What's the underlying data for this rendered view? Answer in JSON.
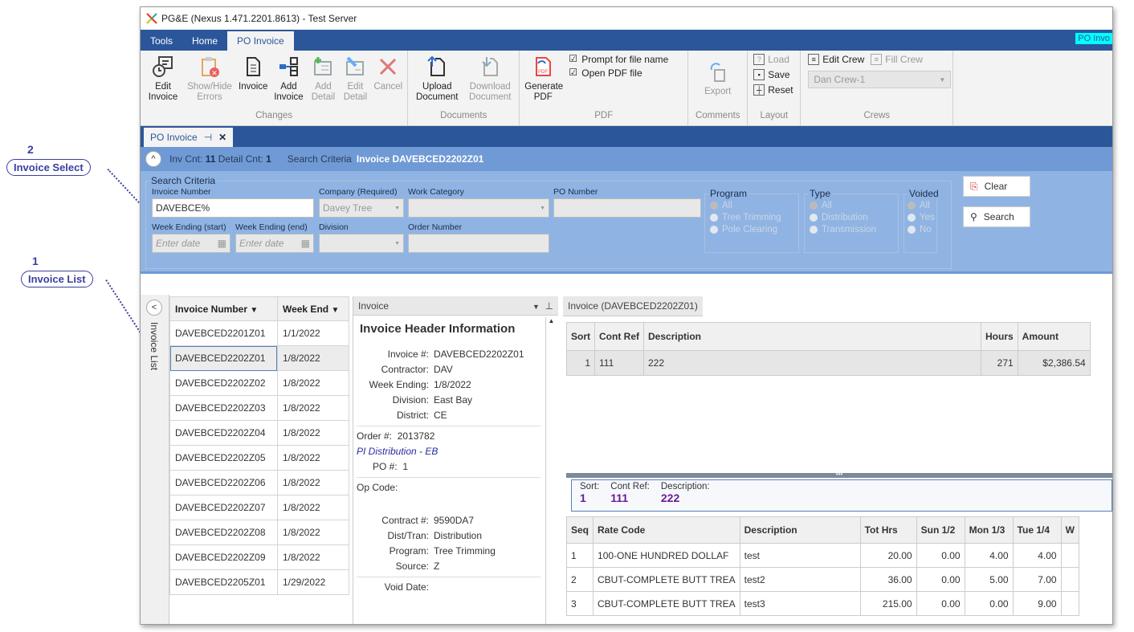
{
  "callouts": [
    {
      "num": "2",
      "label": "Invoice Select"
    },
    {
      "num": "1",
      "label": "Invoice List"
    }
  ],
  "window": {
    "title": "PG&E (Nexus 1.471.2201.8613) - Test Server"
  },
  "menu": {
    "tabs": [
      "Tools",
      "Home",
      "PO Invoice"
    ],
    "context_label": "PO Invo"
  },
  "ribbon": {
    "changes": {
      "label": "Changes",
      "buttons": [
        "Edit Invoice",
        "Show/Hide Errors",
        "Invoice",
        "Add Invoice",
        "Add Detail",
        "Edit Detail",
        "Cancel"
      ]
    },
    "documents": {
      "label": "Documents",
      "buttons": [
        "Upload Document",
        "Download Document"
      ]
    },
    "pdf": {
      "label": "PDF",
      "button": "Generate PDF",
      "prompt": "Prompt for file name",
      "open": "Open PDF file"
    },
    "comments": {
      "label": "Comments",
      "button": "Export"
    },
    "layout": {
      "label": "Layout",
      "load": "Load",
      "save": "Save",
      "reset": "Reset"
    },
    "crews": {
      "label": "Crews",
      "edit": "Edit Crew",
      "fill": "Fill Crew",
      "selected": "Dan Crew-1"
    }
  },
  "doc_tab": {
    "label": "PO Invoice"
  },
  "infobar": {
    "inv_cnt_label": "Inv Cnt:",
    "inv_cnt": "11",
    "detail_cnt_label": "Detail Cnt:",
    "detail_cnt": "1",
    "criteria_label": "Search Criteria",
    "criteria_value": "Invoice DAVEBCED2202Z01"
  },
  "search": {
    "legend": "Search Criteria",
    "invoice_number_label": "Invoice Number",
    "invoice_number": "DAVEBCE%",
    "company_label": "Company (Required)",
    "company": "Davey Tree",
    "work_category_label": "Work Category",
    "po_number_label": "PO Number",
    "week_start_label": "Week Ending (start)",
    "week_end_label": "Week Ending (end)",
    "date_placeholder": "Enter date",
    "division_label": "Division",
    "order_number_label": "Order Number",
    "program": {
      "label": "Program",
      "options": [
        "All",
        "Tree Trimming",
        "Pole Clearing"
      ]
    },
    "type": {
      "label": "Type",
      "options": [
        "All",
        "Distribution",
        "Transmission"
      ]
    },
    "voided": {
      "label": "Voided",
      "options": [
        "All",
        "Yes",
        "No"
      ]
    },
    "clear": "Clear",
    "search": "Search"
  },
  "invoice_list": {
    "side_label": "Invoice List",
    "columns": [
      "Invoice Number",
      "Week End"
    ],
    "rows": [
      [
        "DAVEBCED2201Z01",
        "1/1/2022"
      ],
      [
        "DAVEBCED2202Z01",
        "1/8/2022"
      ],
      [
        "DAVEBCED2202Z02",
        "1/8/2022"
      ],
      [
        "DAVEBCED2202Z03",
        "1/8/2022"
      ],
      [
        "DAVEBCED2202Z04",
        "1/8/2022"
      ],
      [
        "DAVEBCED2202Z05",
        "1/8/2022"
      ],
      [
        "DAVEBCED2202Z06",
        "1/8/2022"
      ],
      [
        "DAVEBCED2202Z07",
        "1/8/2022"
      ],
      [
        "DAVEBCED2202Z08",
        "1/8/2022"
      ],
      [
        "DAVEBCED2202Z09",
        "1/8/2022"
      ],
      [
        "DAVEBCED2205Z01",
        "1/29/2022"
      ]
    ]
  },
  "header_panel": {
    "title": "Invoice",
    "heading": "Invoice Header Information",
    "invoice_label": "Invoice #:",
    "invoice": "DAVEBCED2202Z01",
    "contractor_label": "Contractor:",
    "contractor": "DAV",
    "week_label": "Week Ending:",
    "week": "1/8/2022",
    "division_label": "Division:",
    "division": "East Bay",
    "district_label": "District:",
    "district": "CE",
    "order_label": "Order #:",
    "order": "2013782",
    "order_link": "PI Distribution - EB",
    "po_label": "PO #:",
    "po": "1",
    "opcode_label": "Op Code:",
    "contract_label": "Contract #:",
    "contract": "9590DA7",
    "disttran_label": "Dist/Tran:",
    "disttran": "Distribution",
    "program_label": "Program:",
    "program": "Tree Trimming",
    "source_label": "Source:",
    "source": "Z",
    "void_label": "Void Date:"
  },
  "detail": {
    "tab": "Invoice (DAVEBCED2202Z01)",
    "columns": [
      "Sort",
      "Cont Ref",
      "Description",
      "Hours",
      "Amount"
    ],
    "rows": [
      [
        "1",
        "111",
        "222",
        "271",
        "$2,386.54"
      ]
    ],
    "summary": {
      "sort_label": "Sort:",
      "sort": "1",
      "ref_label": "Cont Ref:",
      "ref": "111",
      "desc_label": "Description:",
      "desc": "222"
    },
    "line_columns": [
      "Seq",
      "Rate Code",
      "Description",
      "Tot Hrs",
      "Sun 1/2",
      "Mon 1/3",
      "Tue 1/4",
      "W"
    ],
    "lines": [
      [
        "1",
        "100-ONE HUNDRED DOLLAF",
        "test",
        "20.00",
        "0.00",
        "4.00",
        "4.00"
      ],
      [
        "2",
        "CBUT-COMPLETE BUTT TREA",
        "test2",
        "36.00",
        "0.00",
        "5.00",
        "7.00"
      ],
      [
        "3",
        "CBUT-COMPLETE BUTT TREA",
        "test3",
        "215.00",
        "0.00",
        "0.00",
        "9.00"
      ]
    ]
  }
}
